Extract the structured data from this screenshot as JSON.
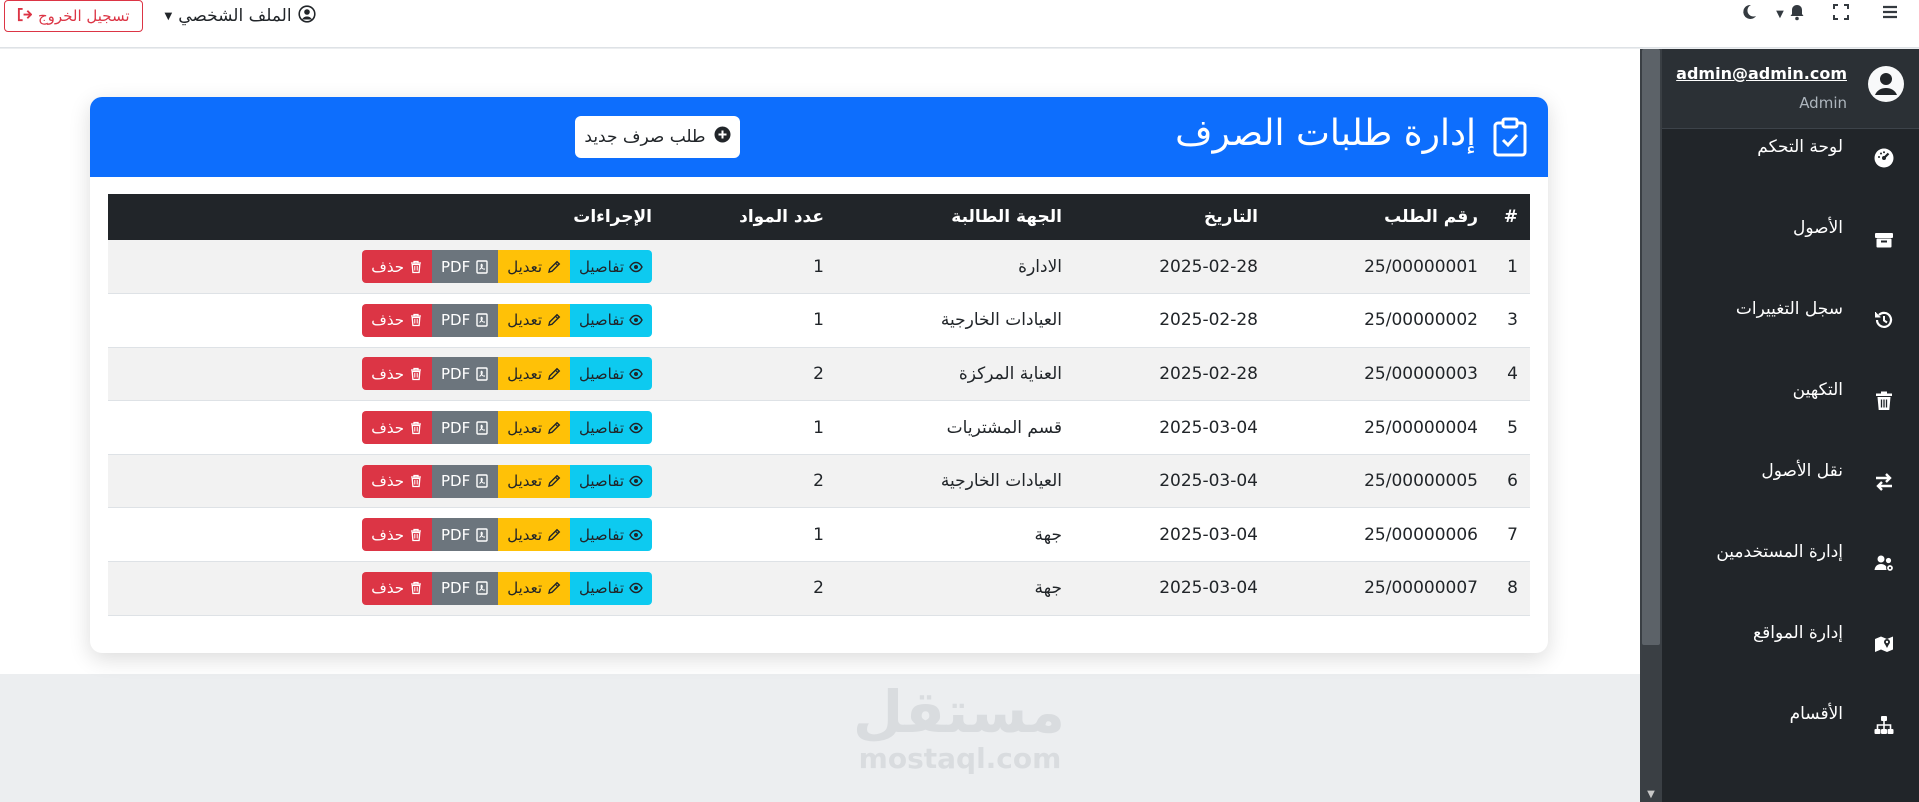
{
  "navbar": {
    "logout_label": "تسجيل الخروج",
    "profile_label": "الملف الشخصي"
  },
  "sidebar": {
    "user_email": "admin@admin.com",
    "user_role": "Admin",
    "items": [
      {
        "label": "لوحة التحكم",
        "icon": "dashboard-icon"
      },
      {
        "label": "الأصول",
        "icon": "box-icon"
      },
      {
        "label": "سجل التغييرات",
        "icon": "history-icon"
      },
      {
        "label": "التكهين",
        "icon": "trash-icon"
      },
      {
        "label": "نقل الأصول",
        "icon": "transfer-icon"
      },
      {
        "label": "إدارة المستخدمين",
        "icon": "users-icon"
      },
      {
        "label": "إدارة المواقع",
        "icon": "map-icon"
      },
      {
        "label": "الأقسام",
        "icon": "sitemap-icon"
      }
    ]
  },
  "card": {
    "title": "إدارة طلبات الصرف",
    "new_button": "طلب صرف جديد"
  },
  "table": {
    "headers": [
      "#",
      "رقم الطلب",
      "التاريخ",
      "الجهة الطالبة",
      "عدد المواد",
      "الإجراءات"
    ],
    "rows": [
      {
        "num": "1",
        "request": "25/00000001",
        "date": "2025-02-28",
        "dept": "الادارة",
        "count": "1"
      },
      {
        "num": "3",
        "request": "25/00000002",
        "date": "2025-02-28",
        "dept": "العيادات الخارجية",
        "count": "1"
      },
      {
        "num": "4",
        "request": "25/00000003",
        "date": "2025-02-28",
        "dept": "العناية المركزة",
        "count": "2"
      },
      {
        "num": "5",
        "request": "25/00000004",
        "date": "2025-03-04",
        "dept": "قسم المشتريات",
        "count": "1"
      },
      {
        "num": "6",
        "request": "25/00000005",
        "date": "2025-03-04",
        "dept": "العيادات الخارجية",
        "count": "2"
      },
      {
        "num": "7",
        "request": "25/00000006",
        "date": "2025-03-04",
        "dept": "جهة",
        "count": "1"
      },
      {
        "num": "8",
        "request": "25/00000007",
        "date": "2025-03-04",
        "dept": "جهة",
        "count": "2"
      }
    ],
    "actions": {
      "details": "تفاصيل",
      "edit": "تعديل",
      "pdf": "PDF",
      "delete": "حذف"
    }
  },
  "watermark": {
    "arabic": "مستقل",
    "latin": "mostaql.com"
  },
  "colors": {
    "primary": "#0d6efd",
    "sidebar_bg": "#212529",
    "info": "#0dcaf0",
    "warning": "#ffc107",
    "secondary": "#6c757d",
    "danger": "#dc3545"
  }
}
